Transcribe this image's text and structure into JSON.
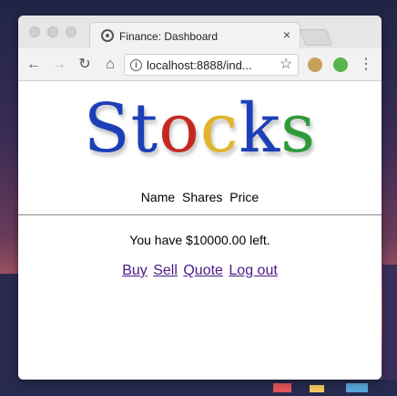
{
  "browser": {
    "tab_title": "Finance: Dashboard",
    "tab_close": "×",
    "url": "localhost:8888/ind..."
  },
  "icons": {
    "favicon": "globe-icon",
    "back": "←",
    "forward": "→",
    "reload": "↻",
    "home": "⌂",
    "info": "i",
    "star": "☆",
    "menu": "⋮"
  },
  "logo": {
    "letters": [
      {
        "char": "S",
        "color": "#1c3fb8"
      },
      {
        "char": "t",
        "color": "#1c3fb8"
      },
      {
        "char": "o",
        "color": "#c4281e"
      },
      {
        "char": "c",
        "color": "#e0b52c"
      },
      {
        "char": "k",
        "color": "#1c3fb8"
      },
      {
        "char": "s",
        "color": "#2f9a3a"
      }
    ]
  },
  "table": {
    "headers": [
      "Name",
      "Shares",
      "Price"
    ]
  },
  "balance_text": "You have $10000.00 left.",
  "nav_links": [
    "Buy",
    "Sell",
    "Quote",
    "Log out"
  ],
  "link_color": "#4b1a86"
}
